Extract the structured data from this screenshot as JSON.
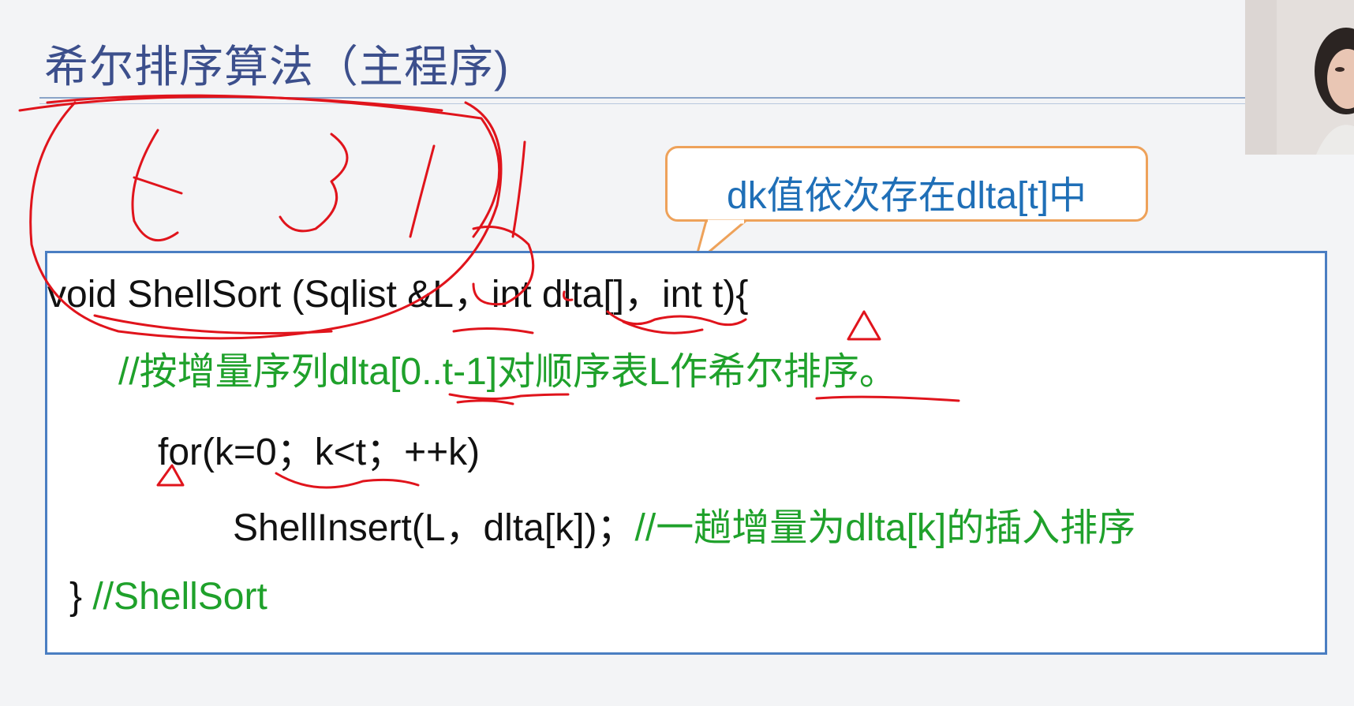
{
  "slide": {
    "title": "希尔排序算法（主程序)",
    "callout": "dk值依次存在dlta[t]中",
    "code": {
      "line1": "void ShellSort (Sqlist &L，int dlta[]，int t){",
      "line2_comment": "//按增量序列dlta[0..t-1]对顺序表L作希尔排序。",
      "line3": "for(k=0；k<t；++k)",
      "line4_code": "ShellInsert(L，dlta[k])；",
      "line4_comment": "//一趟增量为dlta[k]的插入排序",
      "line5_brace": "}",
      "line5_comment": "//ShellSort"
    }
  },
  "annotation": {
    "handwritten": "5,3,1",
    "ink_color": "#e0141c"
  },
  "colors": {
    "title": "#3c4f8c",
    "comment_green": "#1fa12b",
    "callout_text": "#1f6fb7",
    "callout_border": "#eea25a",
    "code_border": "#4a7ec2"
  }
}
